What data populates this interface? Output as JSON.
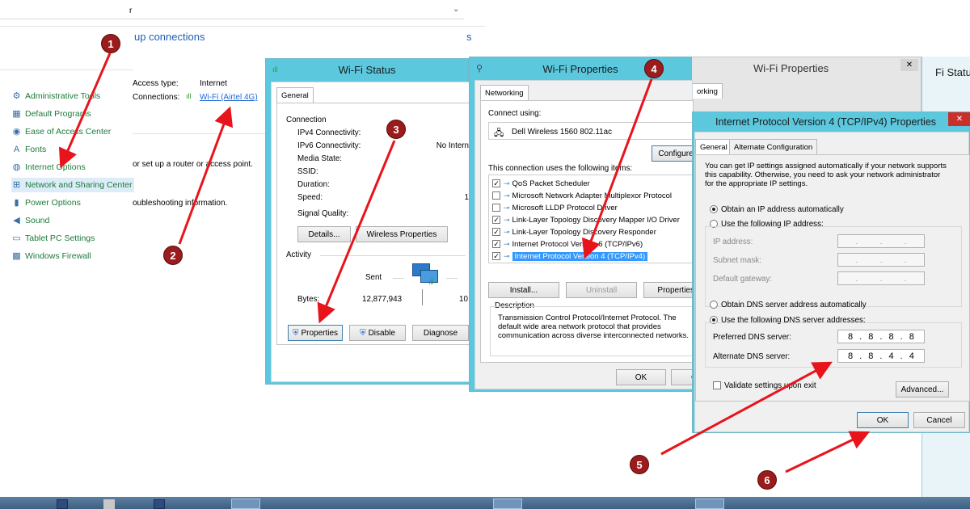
{
  "control_panel": {
    "address_text": "r",
    "heading_fragment": "up connections",
    "heading_fragment2": "s",
    "access_type_label": "Access type:",
    "access_type_value": "Internet",
    "connections_label": "Connections:",
    "connections_value": "Wi-Fi (Airtel 4G)",
    "router_text": "or set up a router or access point.",
    "troubleshoot_text": "oubleshooting information.",
    "items": [
      {
        "label": "Administrative Tools",
        "icon": "tools-icon"
      },
      {
        "label": "Default Programs",
        "icon": "programs-icon"
      },
      {
        "label": "Ease of Access Center",
        "icon": "ease-icon"
      },
      {
        "label": "Fonts",
        "icon": "fonts-icon"
      },
      {
        "label": "Internet Options",
        "icon": "globe-icon"
      },
      {
        "label": "Network and Sharing Center",
        "icon": "network-icon"
      },
      {
        "label": "Power Options",
        "icon": "power-icon"
      },
      {
        "label": "Sound",
        "icon": "sound-icon"
      },
      {
        "label": "Tablet PC Settings",
        "icon": "tablet-icon"
      },
      {
        "label": "Windows Firewall",
        "icon": "firewall-icon"
      }
    ]
  },
  "wifi_status": {
    "title": "Wi-Fi Status",
    "tab": "General",
    "connection_group": "Connection",
    "rows": [
      {
        "label": "IPv4 Connectivity:",
        "value": ""
      },
      {
        "label": "IPv6 Connectivity:",
        "value": "No Intern"
      },
      {
        "label": "Media State:",
        "value": ""
      },
      {
        "label": "SSID:",
        "value": ""
      },
      {
        "label": "Duration:",
        "value": ""
      },
      {
        "label": "Speed:",
        "value": "1"
      }
    ],
    "signal_label": "Signal Quality:",
    "details_btn": "Details...",
    "wireless_btn": "Wireless Properties",
    "activity_group": "Activity",
    "sent_label": "Sent",
    "bytes_label": "Bytes:",
    "bytes_sent": "12,877,943",
    "bytes_received": "10",
    "properties_btn": "Properties",
    "disable_btn": "Disable",
    "diagnose_btn": "Diagnose"
  },
  "wifi_props": {
    "title": "Wi-Fi Properties",
    "tab": "Networking",
    "connect_using_label": "Connect using:",
    "adapter": "Dell Wireless 1560 802.11ac",
    "configure_btn": "Configure",
    "items_label": "This connection uses the following items:",
    "items": [
      {
        "label": "QoS Packet Scheduler",
        "checked": true
      },
      {
        "label": "Microsoft Network Adapter Multiplexor Protocol",
        "checked": false
      },
      {
        "label": "Microsoft LLDP Protocol Driver",
        "checked": false
      },
      {
        "label": "Link-Layer Topology Discovery Mapper I/O Driver",
        "checked": true
      },
      {
        "label": "Link-Layer Topology Discovery Responder",
        "checked": true
      },
      {
        "label": "Internet Protocol Version 6 (TCP/IPv6)",
        "checked": true
      },
      {
        "label": "Internet Protocol Version 4 (TCP/IPv4)",
        "checked": true
      }
    ],
    "install_btn": "Install...",
    "uninstall_btn": "Uninstall",
    "properties_btn": "Properties",
    "description_group": "Description",
    "description": "Transmission Control Protocol/Internet Protocol. The default wide area network protocol that provides communication across diverse interconnected networks.",
    "ok_btn": "OK",
    "cancel_btn": "Ca"
  },
  "wifi_props_back": {
    "title": "Wi-Fi Properties",
    "tab": "orking",
    "close": "✕"
  },
  "wifi_status_back": {
    "title": "Fi Status"
  },
  "ipv4": {
    "title": "Internet Protocol Version 4 (TCP/IPv4) Properties",
    "close": "✕",
    "tab_general": "General",
    "tab_alternate": "Alternate Configuration",
    "intro": "You can get IP settings assigned automatically if your network supports this capability. Otherwise, you need to ask your network administrator for the appropriate IP settings.",
    "obtain_ip": "Obtain an IP address automatically",
    "use_ip": "Use the following IP address:",
    "ip_label": "IP address:",
    "mask_label": "Subnet mask:",
    "gateway_label": "Default gateway:",
    "obtain_dns": "Obtain DNS server address automatically",
    "use_dns": "Use the following DNS server addresses:",
    "preferred_label": "Preferred DNS server:",
    "preferred_value": [
      "8",
      "8",
      "8",
      "8"
    ],
    "alternate_label": "Alternate DNS server:",
    "alternate_value": [
      "8",
      "8",
      "4",
      "4"
    ],
    "validate": "Validate settings upon exit",
    "advanced_btn": "Advanced...",
    "ok_btn": "OK",
    "cancel_btn": "Cancel"
  },
  "steps": [
    "1",
    "2",
    "3",
    "4",
    "5",
    "6"
  ],
  "colors": {
    "title_bar": "#5bc8dd",
    "arrow": "#e8141c",
    "badge": "#9b1c1c",
    "selection": "#3399ff"
  }
}
